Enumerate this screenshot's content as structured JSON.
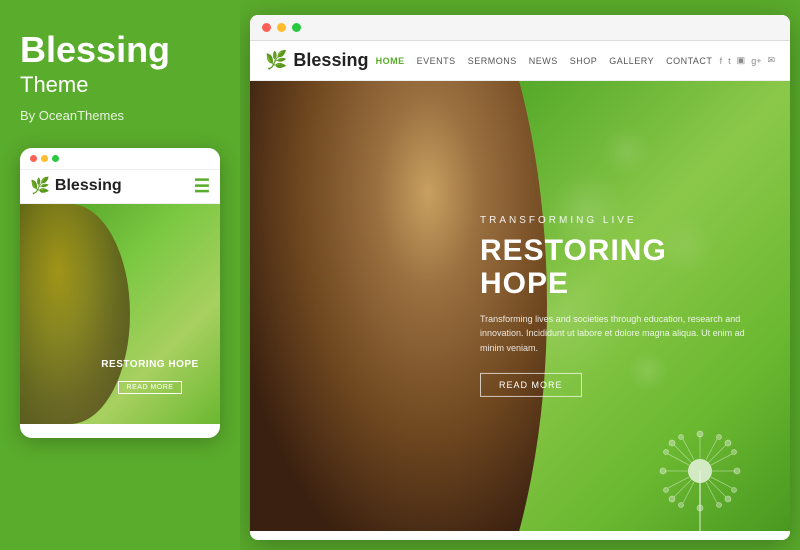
{
  "left": {
    "title": "Blessing",
    "subtitle": "Theme",
    "author": "By OceanThemes"
  },
  "mobile": {
    "dots": [
      "red",
      "yellow",
      "green"
    ],
    "logo_text": "Blessing",
    "hero_title": "RESTORING HOPE",
    "read_more": "READ MORE"
  },
  "desktop": {
    "dots": [
      "red",
      "yellow",
      "green"
    ],
    "logo_text": "Blessing",
    "nav_links": [
      "HOME",
      "EVENTS",
      "SERMONS",
      "NEWS",
      "SHOP",
      "GALLERY",
      "CONTACT"
    ],
    "social_icons": [
      "f",
      "t",
      "rss",
      "g+",
      "mail"
    ],
    "hero_pre_title": "TRANSFORMING LIVE",
    "hero_main_title": "RESTORING HOPE",
    "hero_description": "Transforming lives and societies through education, research and innovation. Incididunt ut labore et dolore magna aliqua. Ut enim ad minim veniam.",
    "read_more": "READ MORE"
  }
}
